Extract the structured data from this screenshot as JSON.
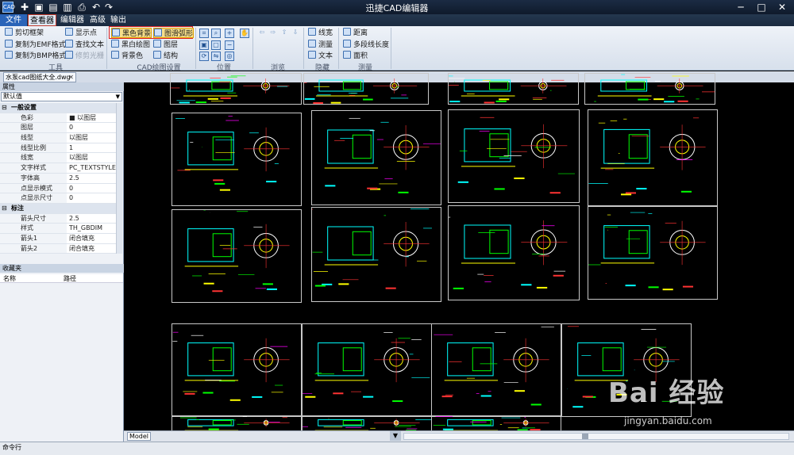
{
  "app": {
    "icon_text": "CAD",
    "title": "迅捷CAD编辑器"
  },
  "menu": {
    "items": [
      "文件",
      "查看器",
      "编辑器",
      "高级",
      "输出"
    ]
  },
  "ribbon": {
    "tools": {
      "label": "工具",
      "items": [
        "剪切框架",
        "复制为EMF格式",
        "复制为BMP格式",
        "显示点",
        "查找文本",
        "修剪光栅"
      ]
    },
    "cad_settings": {
      "label": "CAD绘图设置",
      "items": [
        "黑色背景",
        "黑白绘图",
        "背景色",
        "图层",
        "结构",
        "图滑弧形"
      ]
    },
    "position": {
      "label": "位置"
    },
    "browse": {
      "label": "浏览"
    },
    "hidden": {
      "label": "隐藏",
      "items": [
        "线宽",
        "测量",
        "文本"
      ]
    },
    "measure": {
      "label": "测量",
      "items": [
        "距离",
        "多段线长度",
        "面积"
      ]
    }
  },
  "document": {
    "tab": "水泵cad图纸大全.dwg"
  },
  "properties": {
    "title": "属性",
    "selector": "默认值",
    "rows": [
      {
        "type": "cat",
        "k": "一般设置"
      },
      {
        "k": "色彩",
        "v": "■ 以图层"
      },
      {
        "k": "图层",
        "v": "0"
      },
      {
        "k": "线型",
        "v": "以图层"
      },
      {
        "k": "线型比例",
        "v": "1"
      },
      {
        "k": "线宽",
        "v": "以图层"
      },
      {
        "k": "文字样式",
        "v": "PC_TEXTSTYLE"
      },
      {
        "k": "字体高",
        "v": "2.5"
      },
      {
        "k": "点显示模式",
        "v": "0"
      },
      {
        "k": "点显示尺寸",
        "v": "0"
      },
      {
        "type": "cat",
        "k": "标注"
      },
      {
        "k": "箭头尺寸",
        "v": "2.5"
      },
      {
        "k": "样式",
        "v": "TH_GBDIM"
      },
      {
        "k": "箭头1",
        "v": "闭合填充"
      },
      {
        "k": "箭头2",
        "v": "闭合填充"
      }
    ]
  },
  "favorites": {
    "title": "收藏夹",
    "col_name": "名称",
    "col_path": "路径"
  },
  "model_tab": "Model",
  "command_line": {
    "label": "命令行"
  },
  "watermark": {
    "main": "Bai 经验",
    "url": "jingyan.baidu.com"
  },
  "colors": {
    "accent": "#2a64b8",
    "highlight": "#d22222",
    "canvas": "#000000"
  }
}
